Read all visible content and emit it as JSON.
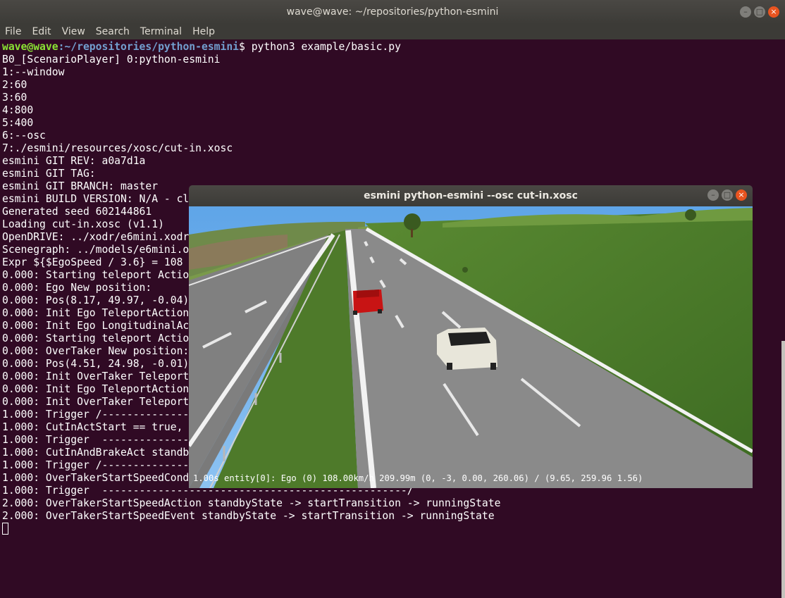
{
  "window": {
    "title": "wave@wave: ~/repositories/python-esmini",
    "menu": [
      "File",
      "Edit",
      "View",
      "Search",
      "Terminal",
      "Help"
    ]
  },
  "terminal": {
    "prompt_user": "wave@wave",
    "prompt_path": ":~/repositories/python-esmini",
    "prompt_suffix": "$ ",
    "command": "python3 example/basic.py",
    "lines": [
      "B0_[ScenarioPlayer] 0:python-esmini",
      "1:--window",
      "2:60",
      "3:60",
      "4:800",
      "5:400",
      "6:--osc",
      "7:./esmini/resources/xosc/cut-in.xosc",
      "esmini GIT REV: a0a7d1a",
      "esmini GIT TAG:",
      "esmini GIT BRANCH: master",
      "esmini BUILD VERSION: N/A - cl",
      "Generated seed 602144861",
      "Loading cut-in.xosc (v1.1)",
      "OpenDRIVE: ../xodr/e6mini.xodr",
      "Scenegraph: ../models/e6mini.o",
      "Expr ${$EgoSpeed / 3.6} = 108",
      "0.000: Starting teleport Actio",
      "0.000: Ego New position:",
      "0.000: Pos(8.17, 49.97, -0.04)",
      "0.000: Init Ego TeleportAction",
      "0.000: Init Ego LongitudinalAc",
      "0.000: Starting teleport Actio",
      "0.000: OverTaker New position:",
      "0.000: Pos(4.51, 24.98, -0.01)",
      "0.000: Init OverTaker Teleport",
      "0.000: Init Ego TeleportAction",
      "0.000: Init OverTaker Teleport",
      "1.000: Trigger /--------------",
      "1.000: CutInActStart == true,",
      "1.000: Trigger  --------------",
      "1.000: CutInAndBrakeAct standb",
      "1.000: Trigger /--------------",
      "1.000: OverTakerStartSpeedCond",
      "1.000: Trigger  -------------------------------------------------/",
      "2.000: OverTakerStartSpeedAction standbyState -> startTransition -> runningState",
      "2.000: OverTakerStartSpeedEvent standbyState -> startTransition -> runningState"
    ]
  },
  "esmini_window": {
    "title": "esmini python-esmini --osc cut-in.xosc",
    "hud": "1.00s entity[0]: Ego (0) 108.00km/h 209.99m (0, -3, 0.00, 260.06) / (9.65, 259.96 1.56)"
  },
  "colors": {
    "terminal_bg": "#300a24",
    "prompt_user": "#8ae234",
    "prompt_path": "#729fcf",
    "close_button": "#e95420",
    "ego_car": "#e8e6da",
    "overtaker_car": "#c81414"
  }
}
